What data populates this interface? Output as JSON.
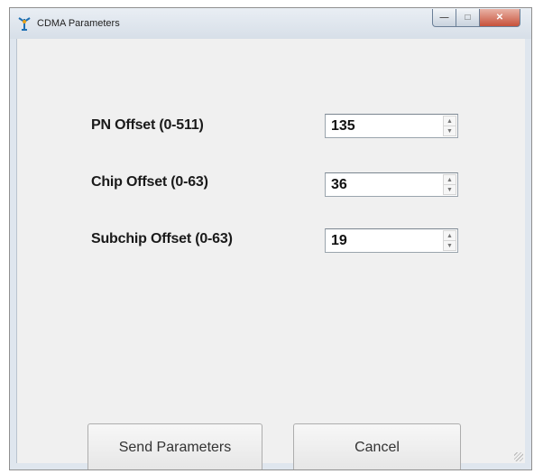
{
  "window": {
    "title": "CDMA Parameters"
  },
  "fields": [
    {
      "label": "PN Offset (0-511)",
      "value": "135"
    },
    {
      "label": "Chip Offset (0-63)",
      "value": "36"
    },
    {
      "label": "Subchip Offset (0-63)",
      "value": "19"
    }
  ],
  "buttons": {
    "send_label": "Send Parameters",
    "cancel_label": "Cancel"
  },
  "icons": {
    "app": "antenna-icon",
    "minimize": "minimize-icon",
    "maximize": "maximize-icon",
    "close": "close-icon",
    "spin_up": "chevron-up-icon",
    "spin_down": "chevron-down-icon"
  }
}
